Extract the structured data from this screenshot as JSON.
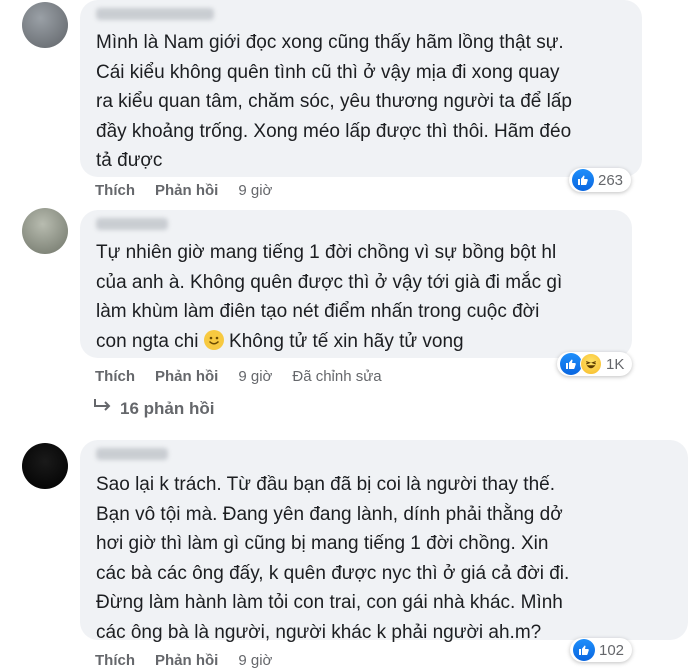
{
  "comments": [
    {
      "text": "Mình là Nam giới đọc xong cũng thấy hãm lồng thật sự.\nCái kiểu không quên tình cũ thì ở vậy mịa đi xong quay\nra kiểu quan tâm, chăm sóc, yêu thương người ta để lấp\nđầy khoảng trống. Xong méo lấp được thì thôi. Hãm đéo\ntả được",
      "like": "Thích",
      "reply": "Phản hồi",
      "time": "9 giờ",
      "reactions": "263",
      "reaction_icons": [
        "like-icon"
      ]
    },
    {
      "text_before_emoji": "Tự nhiên giờ mang tiếng 1 đời chồng vì sự bồng bột hl\ncủa anh à. Không quên được thì ở vậy tới già đi mắc gì\nlàm khùm làm điên tạo nét điểm nhấn trong cuộc đời\ncon ngta chi ",
      "text_after_emoji": " Không tử tế xin hãy tử vong",
      "like": "Thích",
      "reply": "Phản hồi",
      "time": "9 giờ",
      "edited": "Đã chỉnh sửa",
      "reactions": "1K",
      "reaction_icons": [
        "like-icon",
        "haha-icon"
      ],
      "replies_label": "16 phản hồi"
    },
    {
      "text": "Sao lại k trách. Từ đầu bạn đã bị coi là người thay thế.\nBạn vô tội mà. Đang yên đang lành, dính phải thằng dở\nhơi giờ thì làm gì cũng bị mang tiếng 1 đời chồng. Xin\ncác bà các ông đấy, k quên được nyc thì ở giá cả đời đi.\nĐừng làm hành làm tỏi con trai, con gái nhà khác. Mình\ncác ông bà là người, người khác k phải người ah.m?",
      "like": "Thích",
      "reply": "Phản hồi",
      "time": "9 giờ",
      "reactions": "102",
      "reaction_icons": [
        "like-icon"
      ]
    }
  ],
  "colors": {
    "bubble": "#f0f2f5",
    "secondary_text": "#65676b",
    "like_blue": "#1877f2"
  }
}
